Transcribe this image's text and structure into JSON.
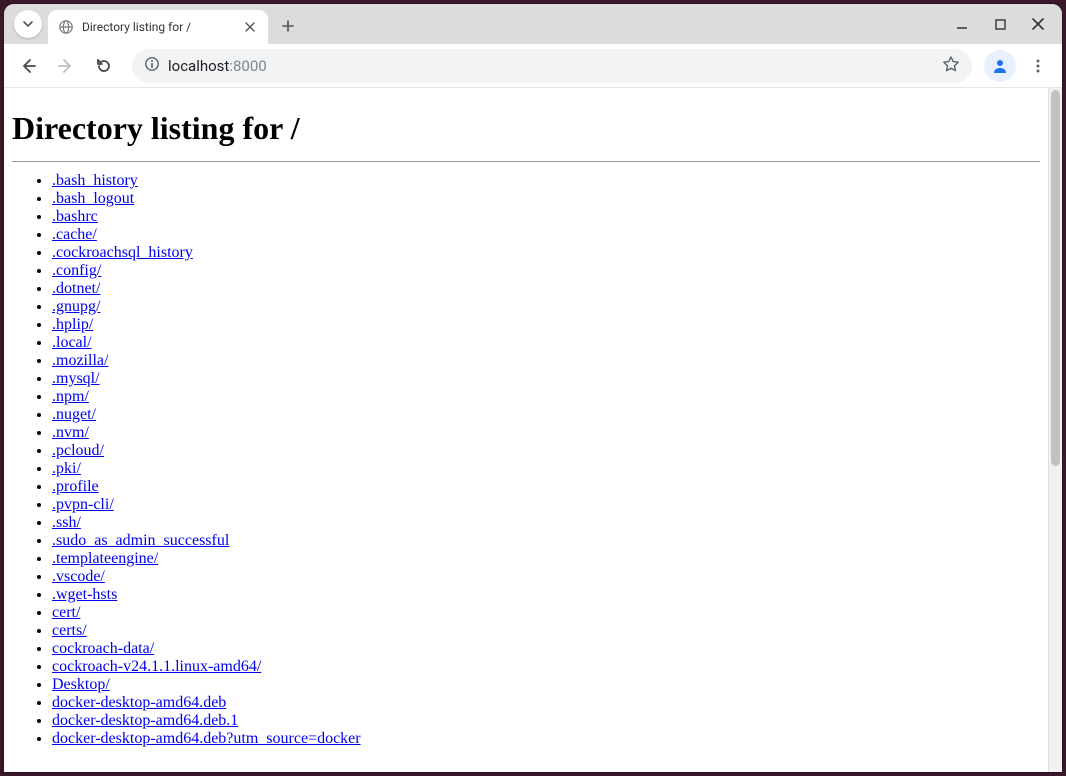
{
  "window": {
    "tab_title": "Directory listing for /"
  },
  "omnibox": {
    "host": "localhost",
    "port": ":8000"
  },
  "page": {
    "heading": "Directory listing for /",
    "entries": [
      ".bash_history",
      ".bash_logout",
      ".bashrc",
      ".cache/",
      ".cockroachsql_history",
      ".config/",
      ".dotnet/",
      ".gnupg/",
      ".hplip/",
      ".local/",
      ".mozilla/",
      ".mysql/",
      ".npm/",
      ".nuget/",
      ".nvm/",
      ".pcloud/",
      ".pki/",
      ".profile",
      ".pvpn-cli/",
      ".ssh/",
      ".sudo_as_admin_successful",
      ".templateengine/",
      ".vscode/",
      ".wget-hsts",
      "cert/",
      "certs/",
      "cockroach-data/",
      "cockroach-v24.1.1.linux-amd64/",
      "Desktop/",
      "docker-desktop-amd64.deb",
      "docker-desktop-amd64.deb.1",
      "docker-desktop-amd64.deb?utm_source=docker"
    ]
  }
}
